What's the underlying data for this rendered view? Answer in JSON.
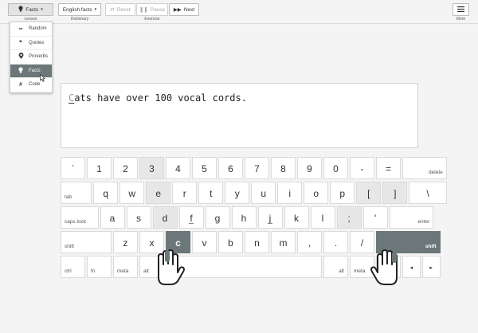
{
  "toolbar": {
    "lesson_label": "Facts",
    "lesson_caption": "Lesson",
    "dictionary_label": "English facts",
    "dictionary_caption": "Dictionary",
    "reset_label": "Reset",
    "pause_label": "Pause",
    "next_label": "Next",
    "exercise_caption": "Exercise",
    "more_caption": "More"
  },
  "lesson_menu": [
    {
      "label": "Random",
      "icon": "infinity-icon",
      "glyph": "∞"
    },
    {
      "label": "Quotes",
      "icon": "quote-icon",
      "glyph": "❞"
    },
    {
      "label": "Proverbs",
      "icon": "pin-icon",
      "glyph": "●"
    },
    {
      "label": "Facts",
      "icon": "lightbulb-icon",
      "glyph": "●",
      "selected": true
    },
    {
      "label": "Code",
      "icon": "hash-icon",
      "glyph": "#"
    }
  ],
  "exercise_text": {
    "current_char": "C",
    "rest": "ats have over 100 vocal cords."
  },
  "keyboard": {
    "active_key": "c",
    "rows": [
      [
        "`",
        "1",
        "2",
        "3",
        "4",
        "5",
        "6",
        "7",
        "8",
        "9",
        "0",
        "-",
        "=",
        "delete"
      ],
      [
        "tab",
        "q",
        "w",
        "e",
        "r",
        "t",
        "y",
        "u",
        "i",
        "o",
        "p",
        "[",
        "]",
        "\\"
      ],
      [
        "caps lock",
        "a",
        "s",
        "d",
        "f",
        "g",
        "h",
        "j",
        "k",
        "l",
        ";",
        "'",
        "enter"
      ],
      [
        "shift",
        "z",
        "x",
        "c",
        "v",
        "b",
        "n",
        "m",
        ",",
        ".",
        "/",
        "shift"
      ],
      [
        "ctrl",
        "fn",
        "meta",
        "alt",
        "",
        "alt",
        "meta",
        "ctrl",
        "◂",
        "▸"
      ]
    ]
  },
  "colors": {
    "accent": "#6b7778",
    "background": "#f4f4f4",
    "key_dark": "#e7e7e7"
  }
}
